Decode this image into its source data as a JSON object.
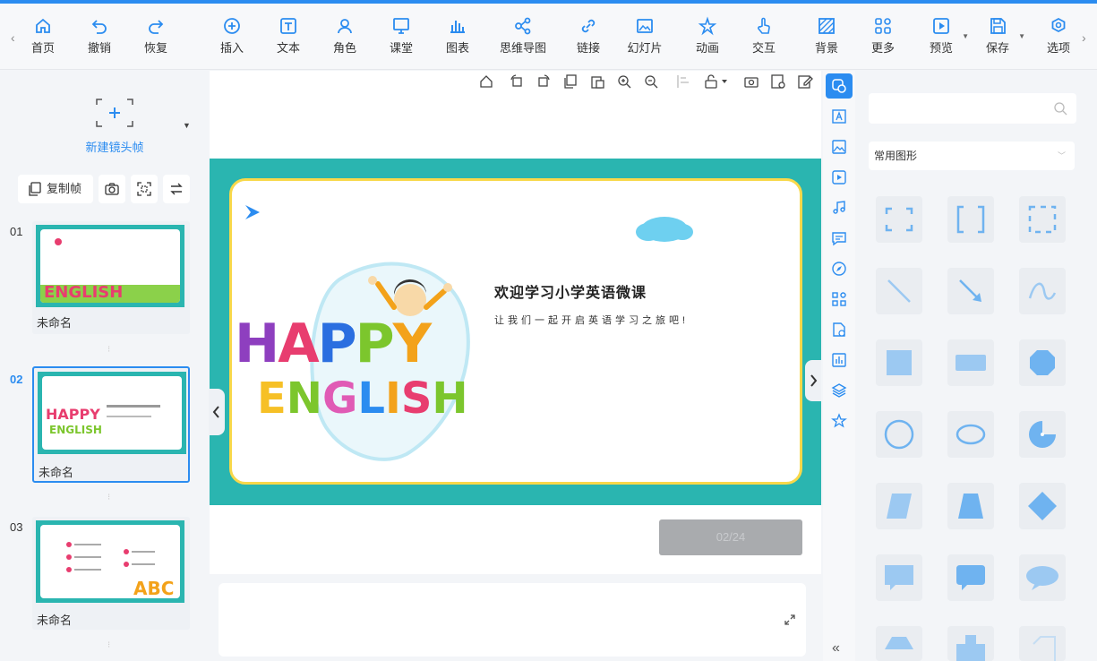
{
  "toolbar": {
    "items": [
      {
        "label": "首页",
        "icon": "home-icon"
      },
      {
        "label": "撤销",
        "icon": "undo-icon"
      },
      {
        "label": "恢复",
        "icon": "redo-icon"
      },
      {
        "label": "插入",
        "icon": "insert-plus-icon"
      },
      {
        "label": "文本",
        "icon": "text-icon"
      },
      {
        "label": "角色",
        "icon": "character-icon"
      },
      {
        "label": "课堂",
        "icon": "classroom-icon"
      },
      {
        "label": "图表",
        "icon": "chart-icon"
      },
      {
        "label": "思维导图",
        "icon": "mindmap-icon"
      },
      {
        "label": "链接",
        "icon": "link-icon"
      },
      {
        "label": "幻灯片",
        "icon": "slideshow-icon"
      },
      {
        "label": "动画",
        "icon": "animation-star-icon"
      },
      {
        "label": "交互",
        "icon": "interaction-hand-icon"
      },
      {
        "label": "背景",
        "icon": "background-icon"
      },
      {
        "label": "更多",
        "icon": "more-grid-icon"
      },
      {
        "label": "预览",
        "icon": "preview-play-icon"
      },
      {
        "label": "保存",
        "icon": "save-icon"
      },
      {
        "label": "选项",
        "icon": "options-gear-icon"
      }
    ],
    "accent": "#2b8cf0"
  },
  "left_panel": {
    "new_frame_label": "新建镜头帧",
    "copy_frame_label": "复制帧",
    "slides": [
      {
        "number": "01",
        "name": "未命名"
      },
      {
        "number": "02",
        "name": "未命名"
      },
      {
        "number": "03",
        "name": "未命名"
      }
    ]
  },
  "slide": {
    "title": "欢迎学习小学英语微课",
    "subtitle": "让我们一起开启英语学习之旅吧!",
    "happy_letters": [
      {
        "ch": "H",
        "color": "#8e3fbf"
      },
      {
        "ch": "A",
        "color": "#e83d6f"
      },
      {
        "ch": "P",
        "color": "#2b6fe0"
      },
      {
        "ch": "P",
        "color": "#7cc62d"
      },
      {
        "ch": "Y",
        "color": "#f3a21a"
      }
    ],
    "english_letters": [
      {
        "ch": "E",
        "color": "#f6c026"
      },
      {
        "ch": "N",
        "color": "#7cc62d"
      },
      {
        "ch": "G",
        "color": "#e05bb5"
      },
      {
        "ch": "L",
        "color": "#2b8cf0"
      },
      {
        "ch": "I",
        "color": "#f3a21a"
      },
      {
        "ch": "S",
        "color": "#e83d6f"
      },
      {
        "ch": "H",
        "color": "#7cc62d"
      }
    ],
    "teal": "#2ab5b0",
    "border_yellow": "#f8d84a"
  },
  "page_indicator": "02/24",
  "right_panel": {
    "category": "常用图形"
  }
}
